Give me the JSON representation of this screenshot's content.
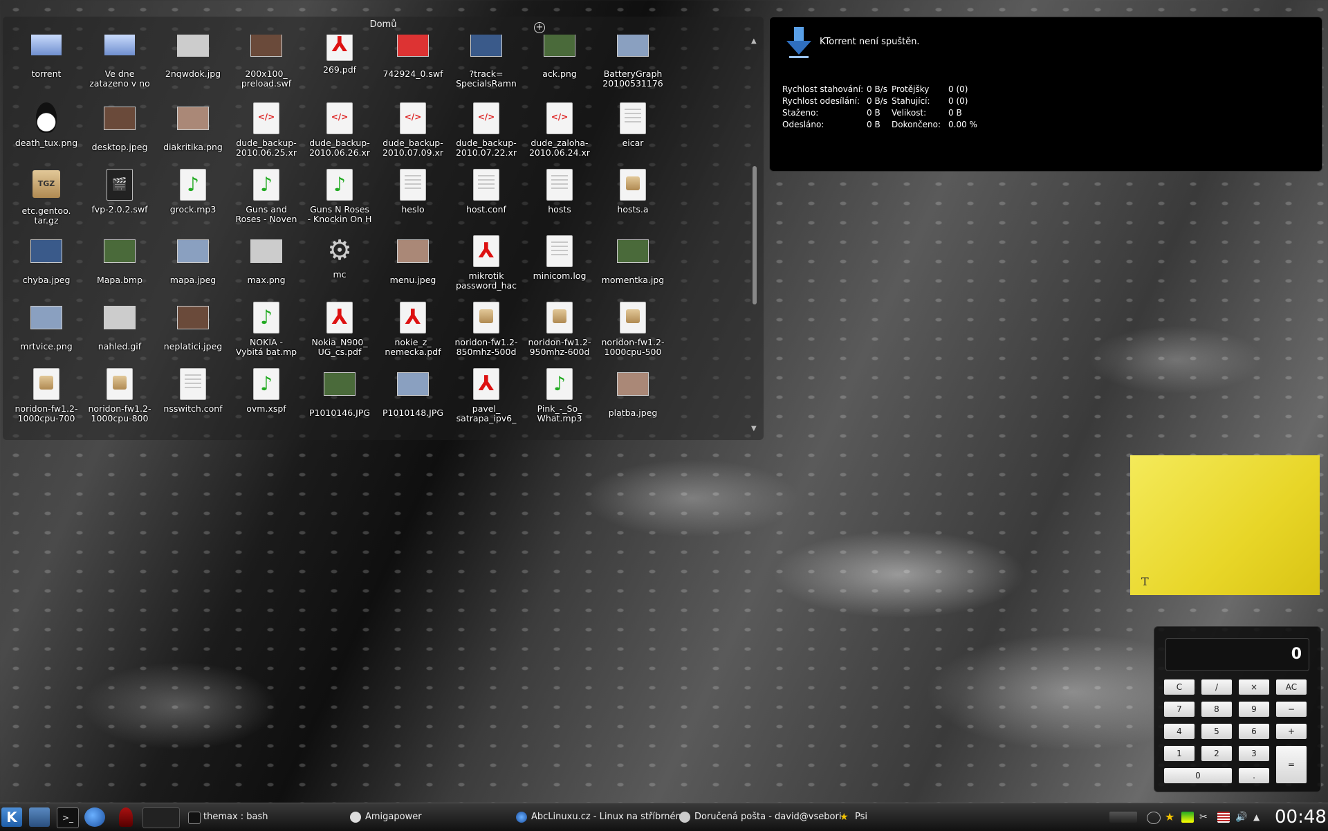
{
  "folder_view": {
    "title": "Domů",
    "items": [
      {
        "label": "torrent",
        "icon": "folder-icon"
      },
      {
        "label": "Ve dne\nzatazeno v no",
        "icon": "folder-icon"
      },
      {
        "label": "2nqwdok.jpg",
        "icon": "image-icon"
      },
      {
        "label": "200x100_\npreload.swf",
        "icon": "image-icon"
      },
      {
        "label": "269.pdf",
        "icon": "pdf-icon"
      },
      {
        "label": "742924_0.swf",
        "icon": "image-icon"
      },
      {
        "label": "?track=\nSpecialsRamn",
        "icon": "image-icon"
      },
      {
        "label": "ack.png",
        "icon": "image-icon"
      },
      {
        "label": "BatteryGraph\n20100531176",
        "icon": "image-icon"
      },
      {
        "label": "death_tux.png",
        "icon": "tux-icon"
      },
      {
        "label": "desktop.jpeg",
        "icon": "image-icon"
      },
      {
        "label": "diakritika.png",
        "icon": "image-icon"
      },
      {
        "label": "dude_backup-\n2010.06.25.xr",
        "icon": "xml-icon"
      },
      {
        "label": "dude_backup-\n2010.06.26.xr",
        "icon": "xml-icon"
      },
      {
        "label": "dude_backup-\n2010.07.09.xr",
        "icon": "xml-icon"
      },
      {
        "label": "dude_backup-\n2010.07.22.xr",
        "icon": "xml-icon"
      },
      {
        "label": "dude_zaloha-\n2010.06.24.xr",
        "icon": "xml-icon"
      },
      {
        "label": "eicar",
        "icon": "text-icon"
      },
      {
        "label": "etc.gentoo.\ntar.gz",
        "icon": "archive-icon"
      },
      {
        "label": "fvp-2.0.2.swf",
        "icon": "video-icon"
      },
      {
        "label": "grock.mp3",
        "icon": "audio-icon"
      },
      {
        "label": "Guns and\nRoses - Noven",
        "icon": "audio-icon"
      },
      {
        "label": "Guns N Roses\n- Knockin On H",
        "icon": "audio-icon"
      },
      {
        "label": "heslo",
        "icon": "text-icon"
      },
      {
        "label": "host.conf",
        "icon": "text-icon"
      },
      {
        "label": "hosts",
        "icon": "text-icon"
      },
      {
        "label": "hosts.a",
        "icon": "package-icon"
      },
      {
        "label": "chyba.jpeg",
        "icon": "image-icon"
      },
      {
        "label": "Mapa.bmp",
        "icon": "image-icon"
      },
      {
        "label": "mapa.jpeg",
        "icon": "image-icon"
      },
      {
        "label": "max.png",
        "icon": "image-icon"
      },
      {
        "label": "mc",
        "icon": "gear-icon"
      },
      {
        "label": "menu.jpeg",
        "icon": "image-icon"
      },
      {
        "label": "mikrotik\npassword_hac",
        "icon": "pdf-icon"
      },
      {
        "label": "minicom.log",
        "icon": "text-icon"
      },
      {
        "label": "momentka.jpg",
        "icon": "image-icon"
      },
      {
        "label": "mrtvice.png",
        "icon": "image-icon"
      },
      {
        "label": "nahled.gif",
        "icon": "image-icon"
      },
      {
        "label": "neplatici.jpeg",
        "icon": "image-icon"
      },
      {
        "label": "NOKIA -\nVybitá bat.mp",
        "icon": "audio-icon"
      },
      {
        "label": "Nokia_N900_\nUG_cs.pdf",
        "icon": "pdf-icon"
      },
      {
        "label": "nokie_z_\nnemecka.pdf",
        "icon": "pdf-icon"
      },
      {
        "label": "noridon-fw1.2-\n850mhz-500d",
        "icon": "package-icon"
      },
      {
        "label": "noridon-fw1.2-\n950mhz-600d",
        "icon": "package-icon"
      },
      {
        "label": "noridon-fw1.2-\n1000cpu-500",
        "icon": "package-icon"
      },
      {
        "label": "noridon-fw1.2-\n1000cpu-700",
        "icon": "package-icon"
      },
      {
        "label": "noridon-fw1.2-\n1000cpu-800",
        "icon": "package-icon"
      },
      {
        "label": "nsswitch.conf",
        "icon": "text-icon"
      },
      {
        "label": "ovm.xspf",
        "icon": "audio-icon"
      },
      {
        "label": "P1010146.JPG",
        "icon": "image-icon"
      },
      {
        "label": "P1010148.JPG",
        "icon": "image-icon"
      },
      {
        "label": "pavel_\nsatrapa_ipv6_",
        "icon": "pdf-icon"
      },
      {
        "label": "Pink_-_So_\nWhat.mp3",
        "icon": "audio-icon"
      },
      {
        "label": "platba.jpeg",
        "icon": "image-icon"
      }
    ]
  },
  "ktorrent": {
    "title": "KTorrent není spuštěn.",
    "rows": [
      [
        "Rychlost stahování:",
        "0 B/s",
        "Protějšky",
        "0 (0)"
      ],
      [
        "Rychlost odesílání:",
        "0 B/s",
        "Stahující:",
        "0 (0)"
      ],
      [
        "Staženo:",
        "0 B",
        "Velikost:",
        "0 B"
      ],
      [
        "Odesláno:",
        "0 B",
        "Dokončeno:",
        "0.00 %"
      ]
    ]
  },
  "sticky_note": {
    "text": "T"
  },
  "calculator": {
    "display": "0",
    "keys": [
      [
        "C",
        "/",
        "×",
        "AC"
      ],
      [
        "7",
        "8",
        "9",
        "−"
      ],
      [
        "4",
        "5",
        "6",
        "+"
      ],
      [
        "1",
        "2",
        "3",
        "="
      ],
      [
        "0",
        "."
      ]
    ]
  },
  "taskbar": {
    "tasks": [
      {
        "label": "themax : bash",
        "icon": "terminal-icon"
      },
      {
        "label": "Amigapower",
        "icon": "chat-icon"
      },
      {
        "label": "AbcLinuxu.cz - Linux na stříbrném",
        "icon": "browser-icon"
      },
      {
        "label": "Doručená pošta - david@vsebori",
        "icon": "mail-icon"
      },
      {
        "label": "Psi",
        "icon": "star-icon"
      }
    ],
    "clock": "00:48"
  },
  "colors": {
    "accent": "#2f6fbf",
    "sticky": "#eedd33"
  }
}
